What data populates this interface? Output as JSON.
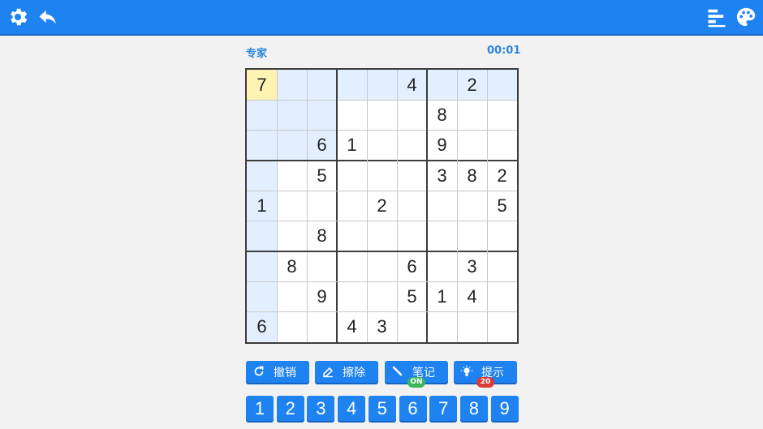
{
  "toolbar": {
    "left_icons": [
      "gear-icon",
      "undo-arrow-icon"
    ],
    "right_icons": [
      "stats-bars-icon",
      "palette-icon"
    ],
    "color": "#1e82f0"
  },
  "game": {
    "difficulty": "专家",
    "timer": "00:01"
  },
  "board": {
    "grid": [
      [
        7,
        0,
        0,
        0,
        0,
        4,
        0,
        2,
        0
      ],
      [
        0,
        0,
        0,
        0,
        0,
        0,
        8,
        0,
        0
      ],
      [
        0,
        0,
        6,
        1,
        0,
        0,
        9,
        0,
        0
      ],
      [
        0,
        0,
        5,
        0,
        0,
        0,
        3,
        8,
        2
      ],
      [
        1,
        0,
        0,
        0,
        2,
        0,
        0,
        0,
        5
      ],
      [
        0,
        0,
        8,
        0,
        0,
        0,
        0,
        0,
        0
      ],
      [
        0,
        8,
        0,
        0,
        0,
        6,
        0,
        3,
        0
      ],
      [
        0,
        0,
        9,
        0,
        0,
        5,
        1,
        4,
        0
      ],
      [
        6,
        0,
        0,
        4,
        3,
        0,
        0,
        0,
        0
      ]
    ],
    "selected_cell": {
      "row": 1,
      "col": 1
    },
    "highlight_color": "#e3efff",
    "selected_color": "#fff3b3"
  },
  "actions": [
    {
      "id": "undo",
      "label": "撤销",
      "icon": "undo-icon"
    },
    {
      "id": "erase",
      "label": "擦除",
      "icon": "eraser-icon"
    },
    {
      "id": "notes",
      "label": "笔记",
      "icon": "pencil-icon",
      "badge": "ON",
      "badge_color": "#3cb55a"
    },
    {
      "id": "hint",
      "label": "提示",
      "icon": "lightbulb-icon",
      "badge": "20",
      "badge_color": "#d93a3a"
    }
  ],
  "number_pad": [
    "1",
    "2",
    "3",
    "4",
    "5",
    "6",
    "7",
    "8",
    "9"
  ]
}
